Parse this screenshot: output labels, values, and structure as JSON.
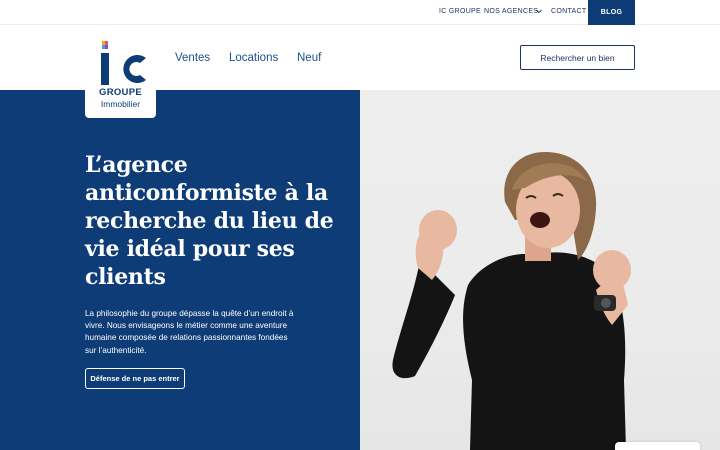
{
  "topbar": {
    "ic_groupe": "IC GROUPE",
    "nos_agences": "NOS AGENCES",
    "contact": "CONTACT",
    "blog": "BLOG"
  },
  "nav": {
    "ventes": "Ventes",
    "locations": "Locations",
    "neuf": "Neuf",
    "search_button": "Rechercher un bien"
  },
  "logo": {
    "mark": "IC",
    "line1": "GROUPE",
    "line2": "Immobilier"
  },
  "hero": {
    "title": "L’agence anticonformiste à la recherche du lieu de vie idéal pour ses clients",
    "text": "La philosophie du groupe dépasse la quête d’un endroit à vivre. Nous envisageons le métier comme une aventure humaine composée de relations passionnantes fondées sur l’authenticité.",
    "button": "Défense de ne pas entrer"
  },
  "colors": {
    "brand_blue": "#0d3c77",
    "nav_blue": "#1d4f8c"
  },
  "icons": [
    "chevron-down-icon",
    "logo-rainbow-accent"
  ]
}
